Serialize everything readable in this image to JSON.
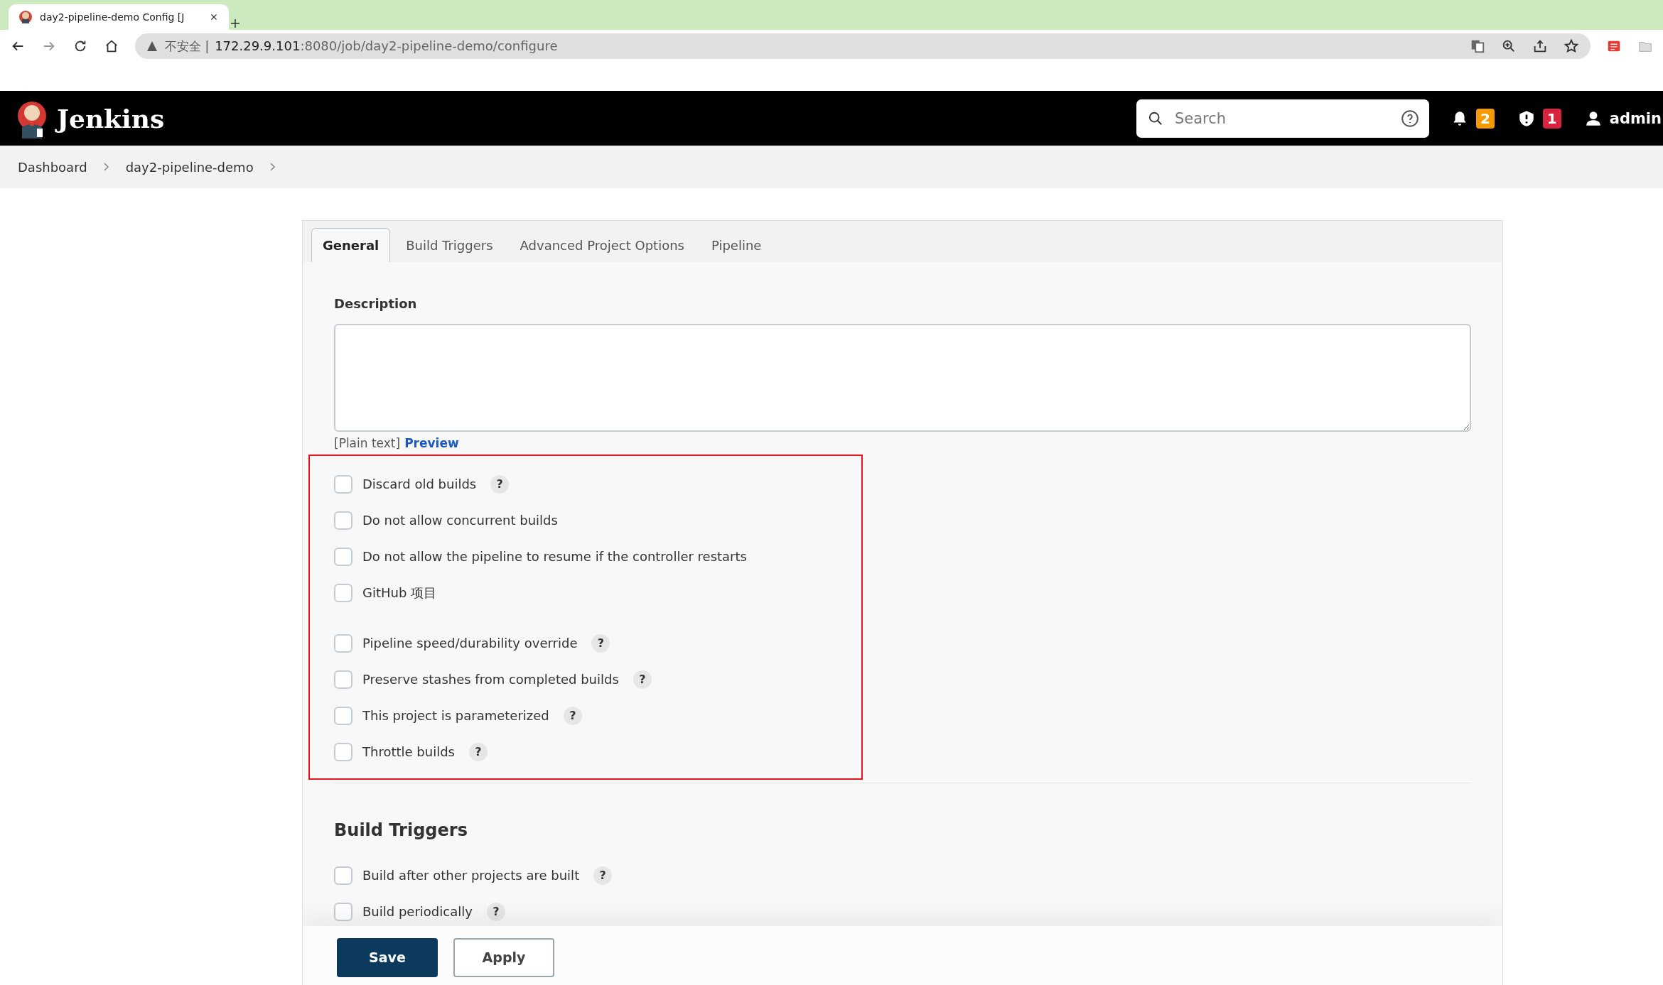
{
  "browser": {
    "tab_title": "day2-pipeline-demo Config [J",
    "security_label": "不安全 |",
    "url_host": "172.29.9.101",
    "url_path": ":8080/job/day2-pipeline-demo/configure"
  },
  "header": {
    "brand": "Jenkins",
    "search": {
      "placeholder": "Search"
    },
    "notifications": "2",
    "security_alerts": "1",
    "user": "admin"
  },
  "breadcrumbs": [
    "Dashboard",
    "day2-pipeline-demo"
  ],
  "tabs": [
    {
      "label": "General",
      "selected": true
    },
    {
      "label": "Build Triggers",
      "selected": false
    },
    {
      "label": "Advanced Project Options",
      "selected": false
    },
    {
      "label": "Pipeline",
      "selected": false
    }
  ],
  "general": {
    "description_label": "Description",
    "format_note": "[Plain text]",
    "preview_link": "Preview",
    "options": [
      {
        "label": "Discard old builds",
        "checked": false,
        "help": "?"
      },
      {
        "label": "Do not allow concurrent builds",
        "checked": false
      },
      {
        "label": "Do not allow the pipeline to resume if the controller restarts",
        "checked": false
      },
      {
        "label": "GitHub 项目",
        "checked": false
      },
      {
        "label": "Pipeline speed/durability override",
        "checked": false,
        "help": "?"
      },
      {
        "label": "Preserve stashes from completed builds",
        "checked": false,
        "help": "?"
      },
      {
        "label": "This project is parameterized",
        "checked": false,
        "help": "?"
      },
      {
        "label": "Throttle builds",
        "checked": false,
        "help": "?"
      }
    ]
  },
  "build_triggers": {
    "title": "Build Triggers",
    "options": [
      {
        "label": "Build after other projects are built",
        "checked": false,
        "help": "?"
      },
      {
        "label": "Build periodically",
        "checked": false,
        "help": "?"
      }
    ]
  },
  "buttons": [
    {
      "label": "Save",
      "kind": "primary"
    },
    {
      "label": "Apply",
      "kind": "secondary"
    }
  ]
}
